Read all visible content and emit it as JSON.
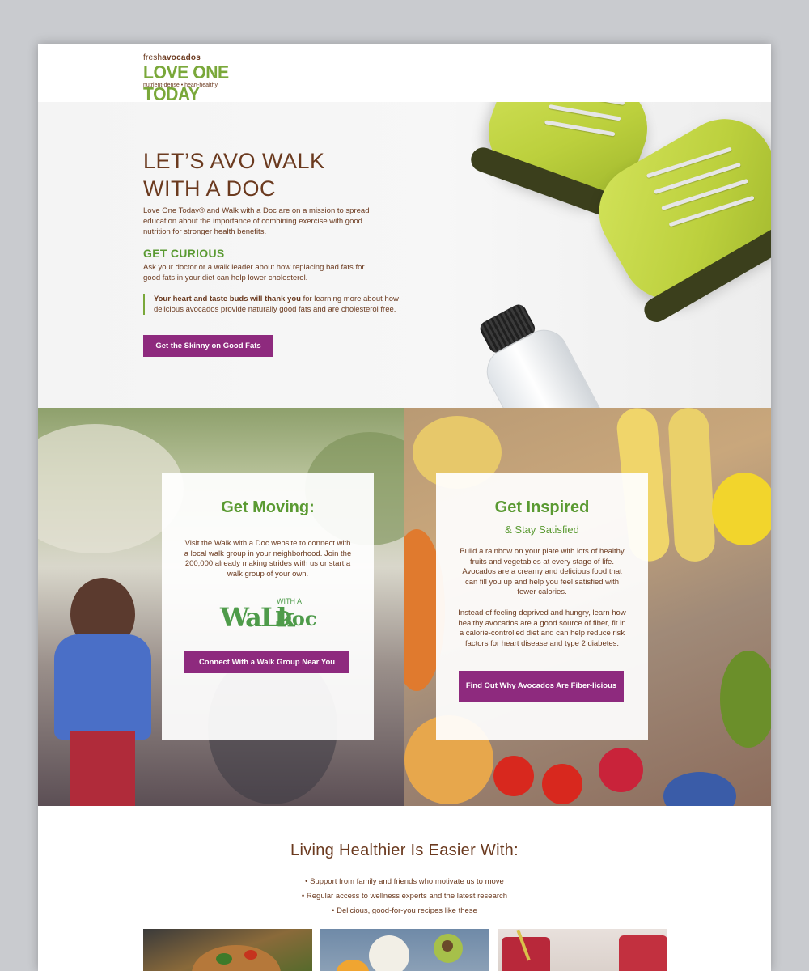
{
  "header": {
    "logo_fresh_prefix": "fresh",
    "logo_fresh_word": "avocados",
    "logo_brand": "LOVE ONE TODAY",
    "logo_tagline": "nutrient-dense • heart-healthy"
  },
  "hero": {
    "title_line1": "LET’S AVO WALK",
    "title_line2": "WITH A DOC",
    "intro": "Love One Today® and Walk with a Doc are on a mission to spread education about the importance of combining exercise with good nutrition for stronger health benefits.",
    "subheading": "GET CURIOUS",
    "subheading_text": "Ask your doctor or a walk leader about how replacing bad fats for good fats in your diet can help lower cholesterol.",
    "quote_bold": "Your heart and taste buds will thank you",
    "quote_rest": " for learning more about how delicious avocados provide naturally good fats and are cholesterol free.",
    "button_label": "Get the Skinny on Good Fats"
  },
  "moving_card": {
    "title": "Get Moving:",
    "text": "Visit the Walk with a Doc website to connect with a local walk group in your neighborhood. Join the 200,000 already making strides with us or start a walk group of your own.",
    "logo_walk": "WaLk",
    "logo_with_a": "WITH A",
    "logo_doc": "Doc",
    "button_label": "Connect With a Walk Group Near You"
  },
  "inspired_card": {
    "title": "Get Inspired",
    "subtitle": "& Stay Satisfied",
    "text1": "Build a rainbow on your plate with lots of healthy fruits and vegetables at every stage of life. Avocados are a creamy and delicious food that can fill you up and help you feel satisfied with fewer calories.",
    "text2": "Instead of feeling deprived and hungry, learn how healthy avocados are a good source of fiber, fit in a calorie-controlled diet and can help reduce risk factors for heart disease and type 2 diabetes.",
    "button_label": "Find Out Why Avocados Are Fiber-licious"
  },
  "living": {
    "title": "Living Healthier Is Easier With:",
    "bullets": [
      "• Support from family and friends who motivate us to move",
      "• Regular access to wellness experts and the latest research",
      "• Delicious, good-for-you recipes like these"
    ]
  },
  "colors": {
    "brand_green": "#5a9a32",
    "brand_brown": "#6b3a1f",
    "button_purple": "#8e2a7e"
  }
}
